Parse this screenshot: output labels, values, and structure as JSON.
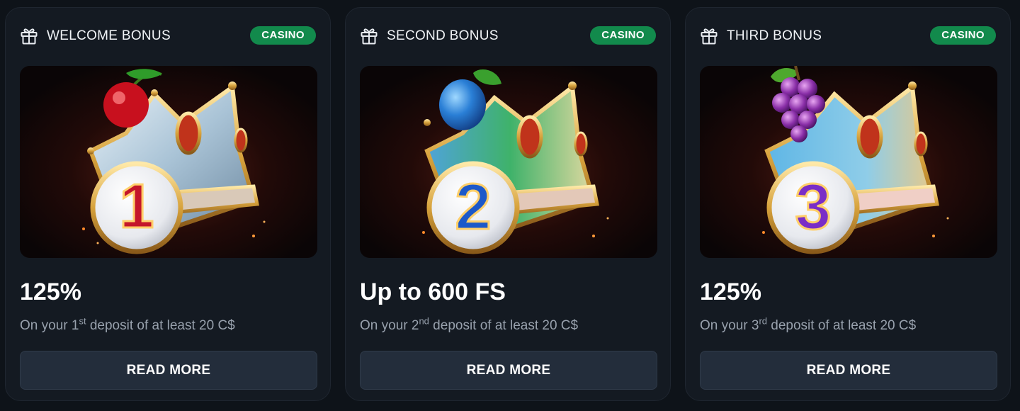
{
  "cards": [
    {
      "title": "WELCOME BONUS",
      "badge": "CASINO",
      "icon": "gift-icon",
      "image": {
        "fruit": "cherry",
        "numeral": "1",
        "numeral_color": "#c4162a"
      },
      "amount": "125%",
      "desc_prefix": "On your 1",
      "desc_sup": "st",
      "desc_suffix": " deposit of at least 20 C$",
      "button": "READ MORE"
    },
    {
      "title": "SECOND BONUS",
      "badge": "CASINO",
      "icon": "gift-icon",
      "image": {
        "fruit": "plum",
        "numeral": "2",
        "numeral_color": "#1d59c9"
      },
      "amount": "Up to 600 FS",
      "desc_prefix": "On your 2",
      "desc_sup": "nd",
      "desc_suffix": " deposit of at least 20 C$",
      "button": "READ MORE"
    },
    {
      "title": "THIRD BONUS",
      "badge": "CASINO",
      "icon": "gift-icon",
      "image": {
        "fruit": "grapes",
        "numeral": "3",
        "numeral_color": "#7a2dc7"
      },
      "amount": "125%",
      "desc_prefix": "On your 3",
      "desc_sup": "rd",
      "desc_suffix": " deposit of at least 20 C$",
      "button": "READ MORE"
    }
  ],
  "colors": {
    "page_bg": "#0e1319",
    "card_bg": "#141a22",
    "badge_bg": "#128a4c",
    "button_bg": "#232d3b",
    "muted_text": "#98a1ad"
  }
}
